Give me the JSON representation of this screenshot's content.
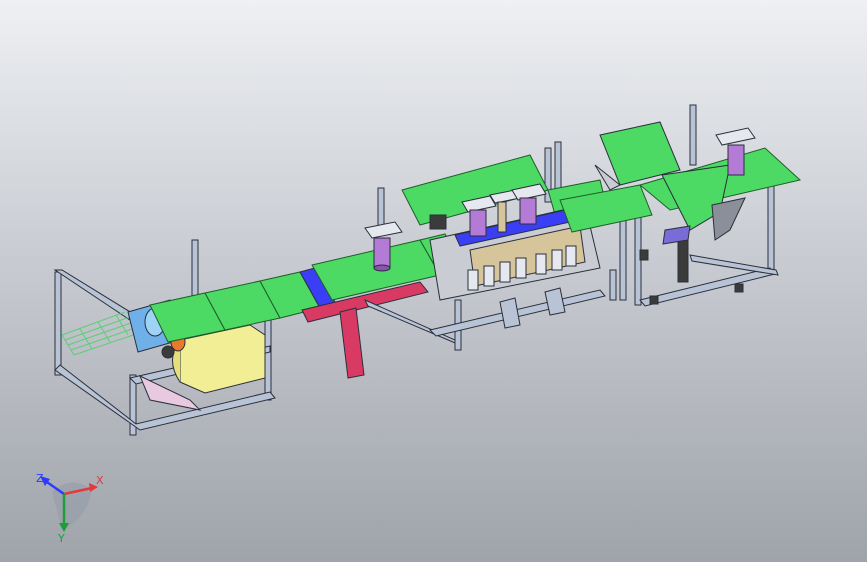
{
  "viewport": {
    "background_top": "#eef0f3",
    "background_bottom": "#9fa3aa"
  },
  "model": {
    "colors": {
      "frame": "#b9c3d6",
      "frame_edge": "#2a2f3a",
      "belt_green": "#4cd964",
      "belt_edge": "#1f5e2a",
      "blue_strip": "#3a3ff5",
      "red_post": "#d83a63",
      "pink_support": "#e9c9e0",
      "yellow_tank": "#f2ee95",
      "spool_purple": "#b37ad6",
      "tan_panel": "#d6c49a",
      "dark_parts": "#3b3b3b"
    }
  },
  "triad": {
    "z_label": "Z",
    "x_label": "X",
    "y_label": "Y",
    "z_color": "#2b3cff",
    "x_color": "#e23a3a",
    "y_color": "#1e9e3a"
  }
}
